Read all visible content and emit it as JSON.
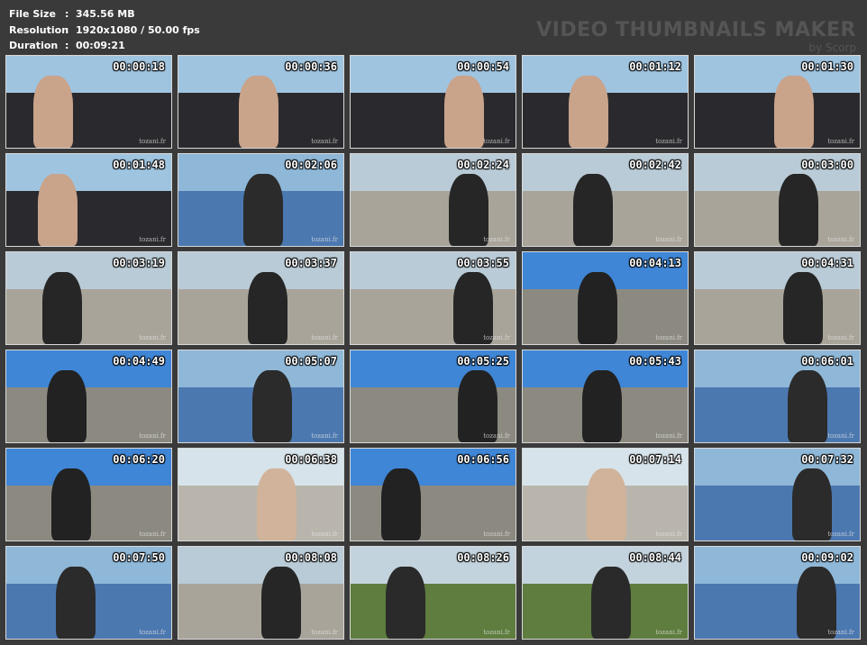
{
  "header": {
    "file_size_label": "File Size",
    "file_size_value": "345.56 MB",
    "resolution_label": "Resolution",
    "resolution_value": "1920x1080 / 50.00 fps",
    "duration_label": "Duration",
    "duration_value": "00:09:21",
    "separator": ":"
  },
  "brand": {
    "title": "VIDEO THUMBNAILS MAKER",
    "subtitle": "by Scorp"
  },
  "watermark": "tozani.fr",
  "thumbnails": [
    {
      "time": "00:00:18",
      "scene": "car-interior"
    },
    {
      "time": "00:00:36",
      "scene": "car-interior"
    },
    {
      "time": "00:00:54",
      "scene": "car-interior"
    },
    {
      "time": "00:01:12",
      "scene": "car-interior"
    },
    {
      "time": "00:01:30",
      "scene": "car-interior"
    },
    {
      "time": "00:01:48",
      "scene": "car-interior"
    },
    {
      "time": "00:02:06",
      "scene": "blue-car"
    },
    {
      "time": "00:02:24",
      "scene": "outdoor-road"
    },
    {
      "time": "00:02:42",
      "scene": "outdoor-road"
    },
    {
      "time": "00:03:00",
      "scene": "outdoor-road"
    },
    {
      "time": "00:03:19",
      "scene": "outdoor-road"
    },
    {
      "time": "00:03:37",
      "scene": "outdoor-road"
    },
    {
      "time": "00:03:55",
      "scene": "outdoor-road"
    },
    {
      "time": "00:04:13",
      "scene": "outdoor-sky"
    },
    {
      "time": "00:04:31",
      "scene": "outdoor-road"
    },
    {
      "time": "00:04:49",
      "scene": "outdoor-sky"
    },
    {
      "time": "00:05:07",
      "scene": "blue-car"
    },
    {
      "time": "00:05:25",
      "scene": "outdoor-sky"
    },
    {
      "time": "00:05:43",
      "scene": "outdoor-sky"
    },
    {
      "time": "00:06:01",
      "scene": "blue-car"
    },
    {
      "time": "00:06:20",
      "scene": "outdoor-sky"
    },
    {
      "time": "00:06:38",
      "scene": "outdoor-bright"
    },
    {
      "time": "00:06:56",
      "scene": "outdoor-sky"
    },
    {
      "time": "00:07:14",
      "scene": "outdoor-bright"
    },
    {
      "time": "00:07:32",
      "scene": "blue-car"
    },
    {
      "time": "00:07:50",
      "scene": "blue-car"
    },
    {
      "time": "00:08:08",
      "scene": "outdoor-road"
    },
    {
      "time": "00:08:26",
      "scene": "outdoor-grass"
    },
    {
      "time": "00:08:44",
      "scene": "outdoor-grass"
    },
    {
      "time": "00:09:02",
      "scene": "blue-car"
    }
  ],
  "palette": {
    "background": "#3a3a3a",
    "header_text": "#ffffff",
    "brand_text": "#555555",
    "thumb_border": "#d8d8d8"
  }
}
